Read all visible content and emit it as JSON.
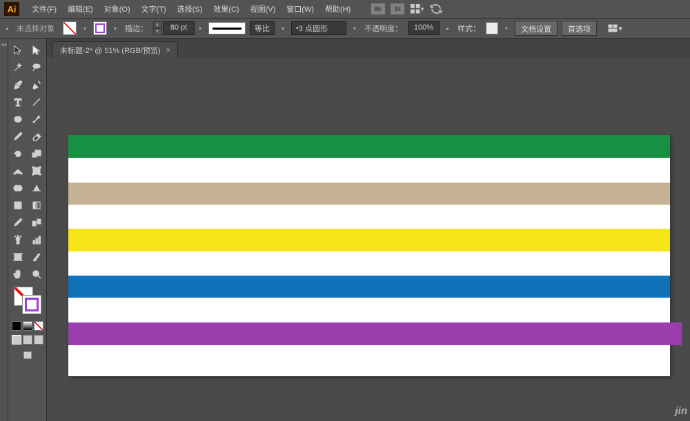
{
  "app": {
    "logo": "Ai"
  },
  "menu": {
    "items": [
      {
        "label": "文件(F)"
      },
      {
        "label": "编辑(E)"
      },
      {
        "label": "对象(O)"
      },
      {
        "label": "文字(T)"
      },
      {
        "label": "选择(S)"
      },
      {
        "label": "效果(C)"
      },
      {
        "label": "视图(V)"
      },
      {
        "label": "窗口(W)"
      },
      {
        "label": "帮助(H)"
      }
    ],
    "icons": [
      {
        "t": "Br"
      },
      {
        "t": "St"
      }
    ]
  },
  "options": {
    "status": "未选择对象",
    "stroke_label": "描边：",
    "stroke_weight": "80 pt",
    "profile": "等比",
    "brush": "3 点圆形",
    "opacity_label": "不透明度：",
    "opacity": "100%",
    "style_label": "样式：",
    "doc_setup": "文档设置",
    "prefs": "首选项"
  },
  "tab": {
    "title": "未标题-2* @ 51% (RGB/预览)",
    "close": "×"
  },
  "stripes": [
    {
      "h": 33,
      "c": "#179042"
    },
    {
      "h": 36,
      "c": "#ffffff"
    },
    {
      "h": 32,
      "c": "#c6b295"
    },
    {
      "h": 35,
      "c": "#ffffff"
    },
    {
      "h": 33,
      "c": "#f6e41a"
    },
    {
      "h": 35,
      "c": "#ffffff"
    },
    {
      "h": 32,
      "c": "#1171b9"
    },
    {
      "h": 36,
      "c": "#ffffff"
    },
    {
      "h": 33,
      "c": "#9a3fad",
      "cls": "purple"
    },
    {
      "h": 45,
      "c": "#ffffff"
    }
  ],
  "watermark": "jin"
}
